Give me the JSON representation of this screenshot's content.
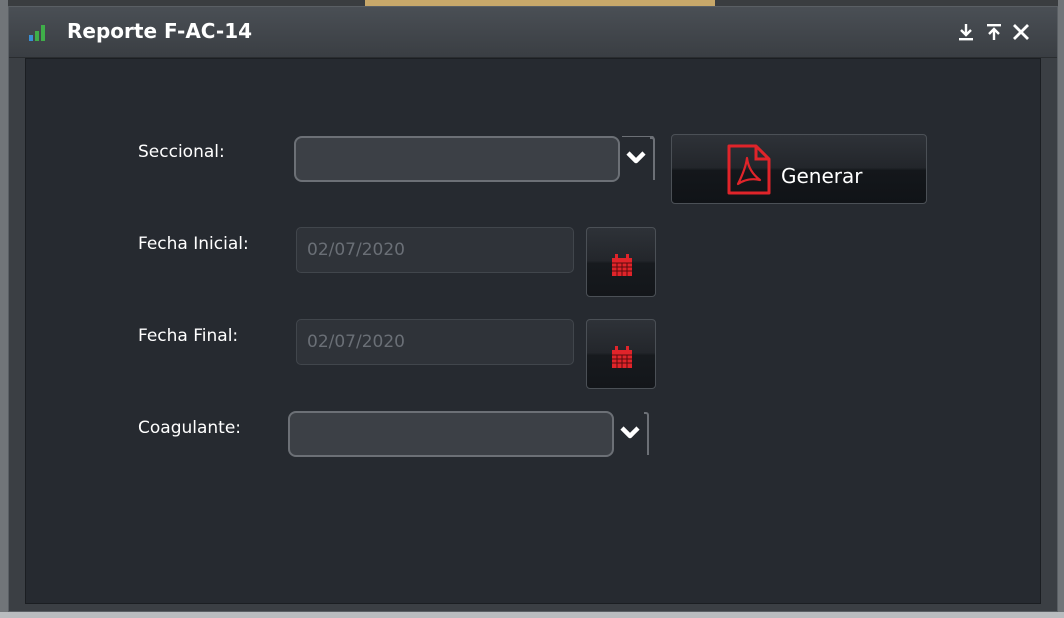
{
  "window": {
    "title": "Reporte F-AC-14",
    "controls": [
      "download-icon",
      "upload-icon",
      "close-icon"
    ]
  },
  "form": {
    "seccional": {
      "label": "Seccional:",
      "value": ""
    },
    "fecha_inicial": {
      "label": "Fecha Inicial:",
      "value": "02/07/2020"
    },
    "fecha_final": {
      "label": "Fecha Final:",
      "value": "02/07/2020"
    },
    "coagulante": {
      "label": "Coagulante:",
      "value": ""
    },
    "generate_button": {
      "label": "Generar",
      "icon": "pdf-icon"
    },
    "calendar_icon": "calendar-icon"
  },
  "colors": {
    "title_bar": "#3f4449",
    "body_background": "#262a30",
    "accent_red": "#e0242a",
    "icon_green": "#3fae49",
    "icon_blue": "#3a8fd6"
  }
}
